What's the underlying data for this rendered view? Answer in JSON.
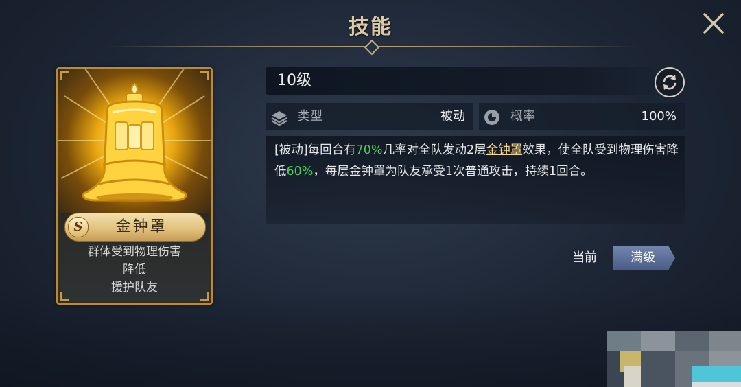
{
  "header": {
    "title": "技能"
  },
  "skill_card": {
    "rank": "S",
    "name": "金钟罩",
    "effect_lines": [
      "群体受到物理伤害",
      "降低",
      "援护队友"
    ]
  },
  "level": {
    "label": "10级"
  },
  "stats": {
    "type_label": "类型",
    "type_value": "被动",
    "chance_label": "概率",
    "chance_value": "100%"
  },
  "description": {
    "parts": [
      {
        "text": "[被动]每回合有",
        "style": "normal"
      },
      {
        "text": "70%",
        "style": "green"
      },
      {
        "text": "几率对全队发动2层",
        "style": "normal"
      },
      {
        "text": "金钟罩",
        "style": "gold"
      },
      {
        "text": "效果，使全队受到物理伤害降低",
        "style": "normal"
      },
      {
        "text": "60%",
        "style": "green"
      },
      {
        "text": "，每层金钟罩为队友承受1次普通攻击，持续1回合。",
        "style": "normal"
      }
    ]
  },
  "level_toggle": {
    "current_label": "当前",
    "max_label": "满级"
  },
  "icons": {
    "close": "close-icon",
    "refresh": "refresh-icon",
    "type": "layers-icon",
    "chance": "dice-icon",
    "skill_art": "golden-bell-icon"
  },
  "colors": {
    "highlight_green": "#46d35a",
    "highlight_gold": "#f4d78b",
    "title": "#d9c9a6",
    "card_border": "#b88b3c",
    "max_button": "#5a6f9a"
  }
}
